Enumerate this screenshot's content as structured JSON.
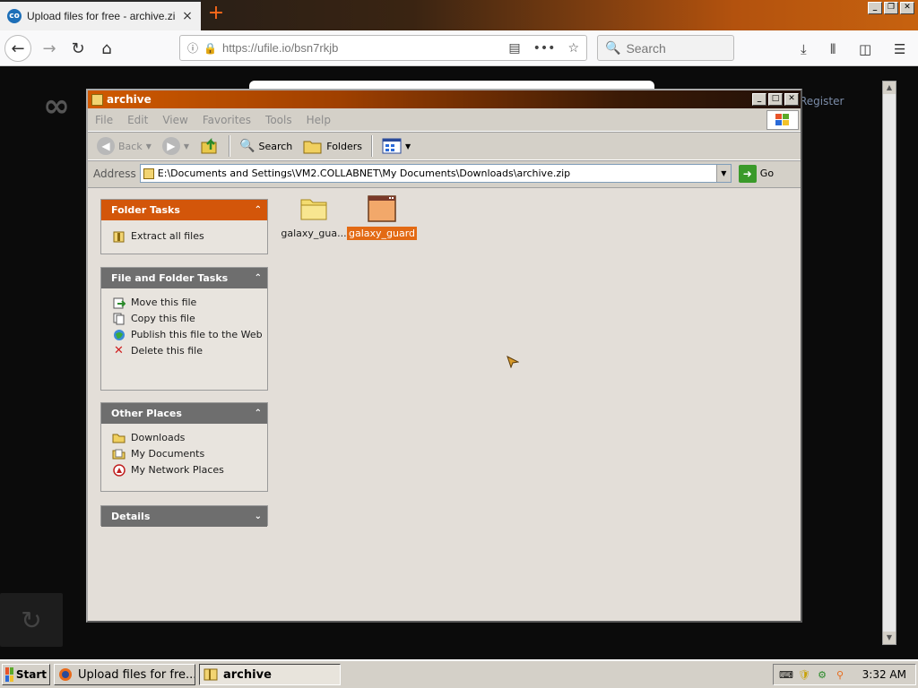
{
  "browser": {
    "tab_title": "Upload files for free - archive.zip - ",
    "tab_close": "×",
    "new_tab": "+",
    "url": "https://ufile.io/bsn7rkjb",
    "search_placeholder": "Search"
  },
  "page": {
    "register_text": "Register"
  },
  "explorer": {
    "title": "archive",
    "menu": [
      "File",
      "Edit",
      "View",
      "Favorites",
      "Tools",
      "Help"
    ],
    "toolbar": {
      "back": "Back",
      "search": "Search",
      "folders": "Folders"
    },
    "address": {
      "label": "Address",
      "path": "E:\\Documents and Settings\\VM2.COLLABNET\\My Documents\\Downloads\\archive.zip",
      "go": "Go"
    },
    "panes": {
      "folder_tasks": {
        "title": "Folder Tasks",
        "items": [
          "Extract all files"
        ]
      },
      "file_folder_tasks": {
        "title": "File and Folder Tasks",
        "items": [
          "Move this file",
          "Copy this file",
          "Publish this file to the Web",
          "Delete this file"
        ]
      },
      "other_places": {
        "title": "Other Places",
        "items": [
          "Downloads",
          "My Documents",
          "My Network Places"
        ]
      },
      "details": {
        "title": "Details"
      }
    },
    "files": [
      {
        "name": "galaxy_gua...",
        "type": "folder"
      },
      {
        "name": "galaxy_guard",
        "type": "application"
      }
    ]
  },
  "taskbar": {
    "start": "Start",
    "tasks": [
      "Upload files for fre...",
      "archive"
    ],
    "clock": "3:32 AM"
  }
}
